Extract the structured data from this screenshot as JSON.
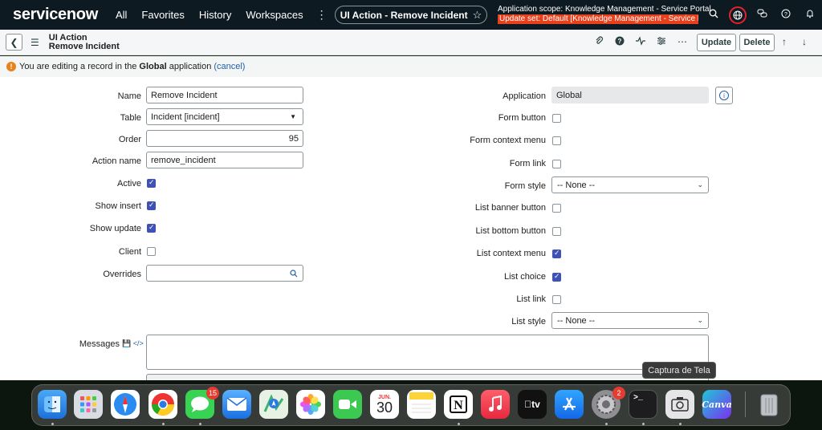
{
  "topnav": {
    "logo": "servicenow",
    "links": [
      "All",
      "Favorites",
      "History",
      "Workspaces"
    ],
    "more": "⋮",
    "record_title": "UI Action - Remove Incident",
    "scope_line": "Application scope: Knowledge Management - Service Portal",
    "update_set_line": "Update set: Default [Knowledge Management - Service Por..."
  },
  "header": {
    "title_line1": "UI Action",
    "title_line2": "Remove Incident",
    "update_label": "Update",
    "delete_label": "Delete"
  },
  "banner": {
    "text_before": "You are editing a record in the ",
    "scope_name": "Global",
    "text_after": " application",
    "cancel_link": "(cancel)"
  },
  "form": {
    "left": {
      "name_label": "Name",
      "name_value": "Remove Incident",
      "table_label": "Table",
      "table_value": "Incident [incident]",
      "order_label": "Order",
      "order_value": "95",
      "action_name_label": "Action name",
      "action_name_value": "remove_incident",
      "active_label": "Active",
      "active_checked": true,
      "show_insert_label": "Show insert",
      "show_insert_checked": true,
      "show_update_label": "Show update",
      "show_update_checked": true,
      "client_label": "Client",
      "client_checked": false,
      "overrides_label": "Overrides",
      "overrides_value": ""
    },
    "right": {
      "application_label": "Application",
      "application_value": "Global",
      "form_button_label": "Form button",
      "form_button_checked": false,
      "form_context_menu_label": "Form context menu",
      "form_context_menu_checked": false,
      "form_link_label": "Form link",
      "form_link_checked": false,
      "form_style_label": "Form style",
      "form_style_value": "-- None --",
      "list_banner_button_label": "List banner button",
      "list_banner_button_checked": false,
      "list_bottom_button_label": "List bottom button",
      "list_bottom_button_checked": false,
      "list_context_menu_label": "List context menu",
      "list_context_menu_checked": true,
      "list_choice_label": "List choice",
      "list_choice_checked": true,
      "list_link_label": "List link",
      "list_link_checked": false,
      "list_style_label": "List style",
      "list_style_value": "-- None --"
    },
    "messages_label": "Messages"
  },
  "dock": {
    "tooltip": "Captura de Tela",
    "messages_badge": "15",
    "settings_badge": "2",
    "calendar_month": "JUN.",
    "calendar_day": "30",
    "canva_label": "Canva",
    "tv_label": "tv"
  }
}
